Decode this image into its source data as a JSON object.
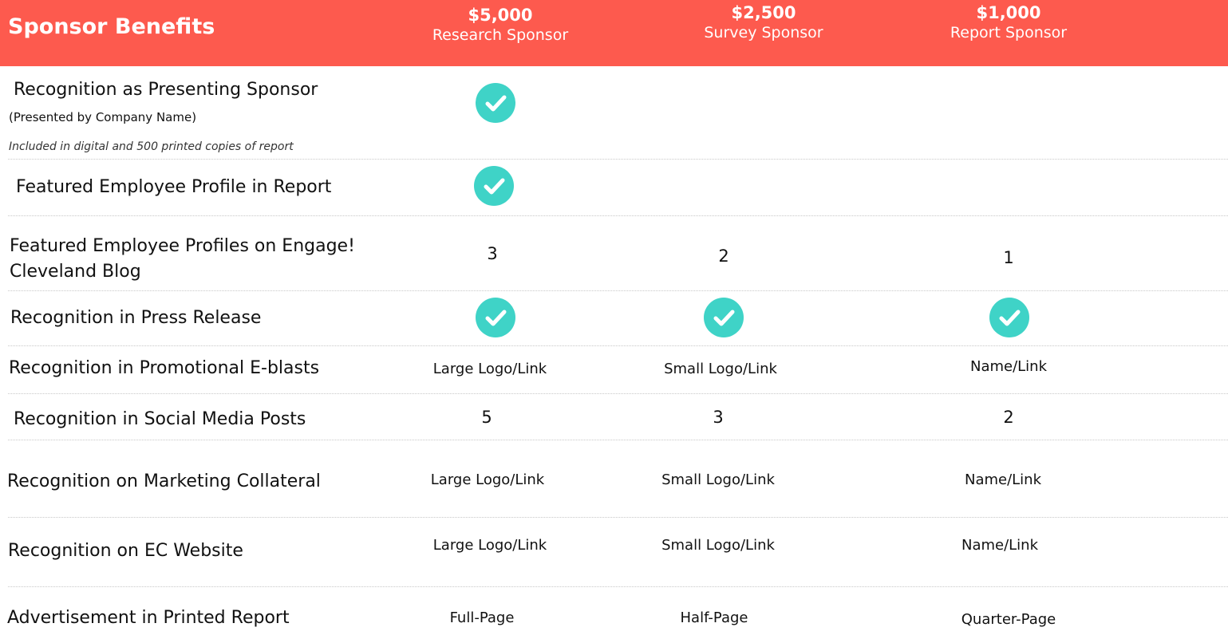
{
  "header": {
    "title": "Sponsor Benefits",
    "tiers": [
      {
        "price": "$5,000",
        "name": "Research Sponsor"
      },
      {
        "price": "$2,500",
        "name": "Survey Sponsor"
      },
      {
        "price": "$1,000",
        "name": "Report Sponsor"
      }
    ]
  },
  "colors": {
    "header_bg": "#fd5a4e",
    "check": "#3fd3c7"
  },
  "rows": [
    {
      "label": "Recognition as Presenting Sponsor",
      "sublabel": "(Presented by Company Name)",
      "note": "Included in digital and 500 printed copies of report",
      "values": [
        "check-icon",
        "",
        ""
      ]
    },
    {
      "label": "Featured Employee Profile in Report",
      "values": [
        "check-icon",
        "",
        ""
      ]
    },
    {
      "label_lines": [
        "Featured Employee Profiles on Engage!",
        "Cleveland Blog"
      ],
      "values": [
        "3",
        "2",
        "1"
      ]
    },
    {
      "label": "Recognition in Press Release",
      "values": [
        "check-icon",
        "check-icon",
        "check-icon"
      ]
    },
    {
      "label": "Recognition in Promotional E-blasts",
      "values": [
        "Large Logo/Link",
        "Small Logo/Link",
        "Name/Link"
      ]
    },
    {
      "label": "Recognition in Social Media Posts",
      "values": [
        "5",
        "3",
        "2"
      ]
    },
    {
      "label": "Recognition on Marketing Collateral",
      "values": [
        "Large Logo/Link",
        "Small Logo/Link",
        "Name/Link"
      ]
    },
    {
      "label": "Recognition on EC Website",
      "values": [
        "Large Logo/Link",
        "Small Logo/Link",
        "Name/Link"
      ]
    },
    {
      "label": "Advertisement in Printed Report",
      "values": [
        "Full-Page",
        "Half-Page",
        "Quarter-Page"
      ]
    }
  ]
}
